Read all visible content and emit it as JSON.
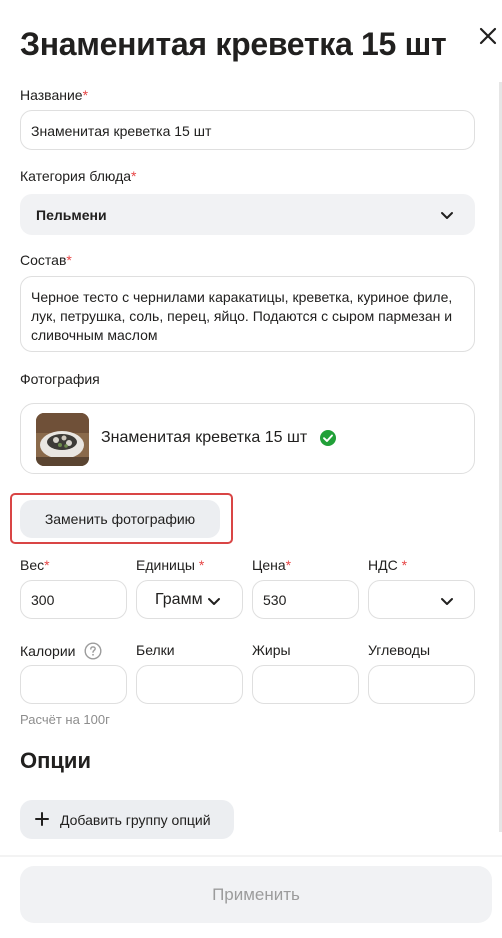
{
  "header": {
    "title": "Знаменитая креветка 15 шт"
  },
  "form": {
    "name": {
      "label": "Название",
      "required_mark": "*",
      "value": "Знаменитая креветка 15 шт"
    },
    "category": {
      "label": "Категория блюда",
      "required_mark": "*",
      "value": "Пельмени"
    },
    "composition": {
      "label": "Состав",
      "required_mark": "*",
      "value": "Черное тесто с чернилами каракатицы, креветка, куриное филе, лук, петрушка, соль, перец, яйцо. Подаются с сыром пармезан и сливочным маслом"
    },
    "photo": {
      "label": "Фотография",
      "file_name": "Знаменитая креветка 15 шт",
      "status_icon": "check-circle-icon",
      "replace_label": "Заменить фотографию"
    },
    "weight": {
      "label": "Вес",
      "required_mark": "*",
      "value": "300"
    },
    "units": {
      "label": "Единицы",
      "required_mark": "*",
      "value": "Грамм"
    },
    "price": {
      "label": "Цена",
      "required_mark": "*",
      "value": "530"
    },
    "vat": {
      "label": "НДС",
      "required_mark": "*",
      "value": ""
    },
    "calories": {
      "label": "Калории",
      "value": ""
    },
    "proteins": {
      "label": "Белки",
      "value": ""
    },
    "fats": {
      "label": "Жиры",
      "value": ""
    },
    "carbs": {
      "label": "Углеводы",
      "value": ""
    },
    "per_hint": "Расчёт на 100г"
  },
  "options": {
    "title": "Опции",
    "add_group_label": "Добавить группу опций"
  },
  "footer": {
    "apply_label": "Применить"
  },
  "colors": {
    "required": "#e64545",
    "success": "#21a038",
    "highlight_border": "#d94545",
    "button_bg": "#eceef1",
    "disabled_text": "#9c9c9c"
  }
}
